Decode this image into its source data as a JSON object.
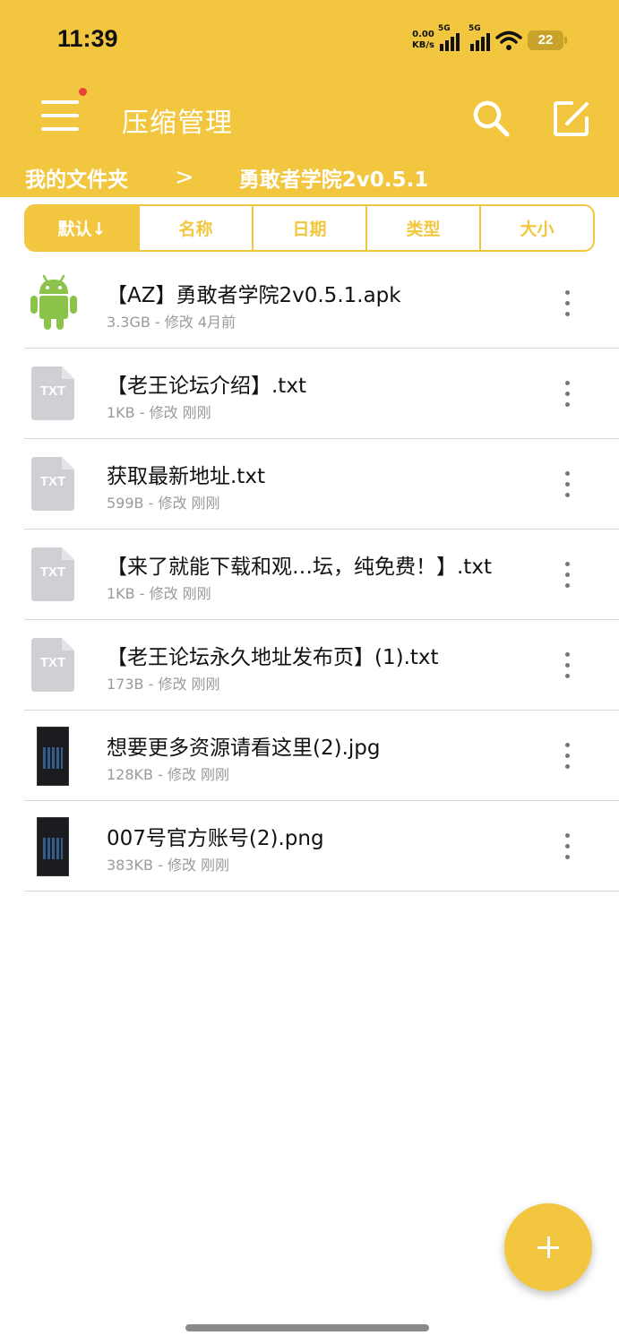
{
  "status_bar": {
    "time": "11:39",
    "speed_value": "0.00",
    "speed_unit": "KB/s",
    "sim1_tag": "5G",
    "sim2_tag": "5G",
    "battery": "22"
  },
  "toolbar": {
    "title": "压缩管理",
    "accent_color": "#f2c73f",
    "menu_icon": "hamburger-menu-icon",
    "search_icon": "search-icon",
    "edit_icon": "edit-icon"
  },
  "breadcrumb": {
    "root": "我的文件夹",
    "separator": ">",
    "current": "勇敢者学院2v0.5.1"
  },
  "sort_tabs": [
    {
      "label": "默认↓",
      "active": true
    },
    {
      "label": "名称",
      "active": false
    },
    {
      "label": "日期",
      "active": false
    },
    {
      "label": "类型",
      "active": false
    },
    {
      "label": "大小",
      "active": false
    }
  ],
  "files": [
    {
      "name": "【AZ】勇敢者学院2v0.5.1.apk",
      "meta": "3.3GB - 修改 4月前",
      "icon": "android-icon"
    },
    {
      "name": "【老王论坛介绍】.txt",
      "meta": "1KB - 修改 刚刚",
      "icon": "txt-file-icon",
      "icon_label": "TXT"
    },
    {
      "name": "获取最新地址.txt",
      "meta": "599B - 修改 刚刚",
      "icon": "txt-file-icon",
      "icon_label": "TXT"
    },
    {
      "name": "【来了就能下载和观…坛，纯免费！】.txt",
      "meta": "1KB - 修改 刚刚",
      "icon": "txt-file-icon",
      "icon_label": "TXT"
    },
    {
      "name": "【老王论坛永久地址发布页】(1).txt",
      "meta": "173B - 修改 刚刚",
      "icon": "txt-file-icon",
      "icon_label": "TXT"
    },
    {
      "name": "想要更多资源请看这里(2).jpg",
      "meta": "128KB - 修改 刚刚",
      "icon": "image-thumbnail"
    },
    {
      "name": "007号官方账号(2).png",
      "meta": "383KB - 修改 刚刚",
      "icon": "image-thumbnail"
    }
  ],
  "fab": {
    "icon": "plus-icon"
  }
}
